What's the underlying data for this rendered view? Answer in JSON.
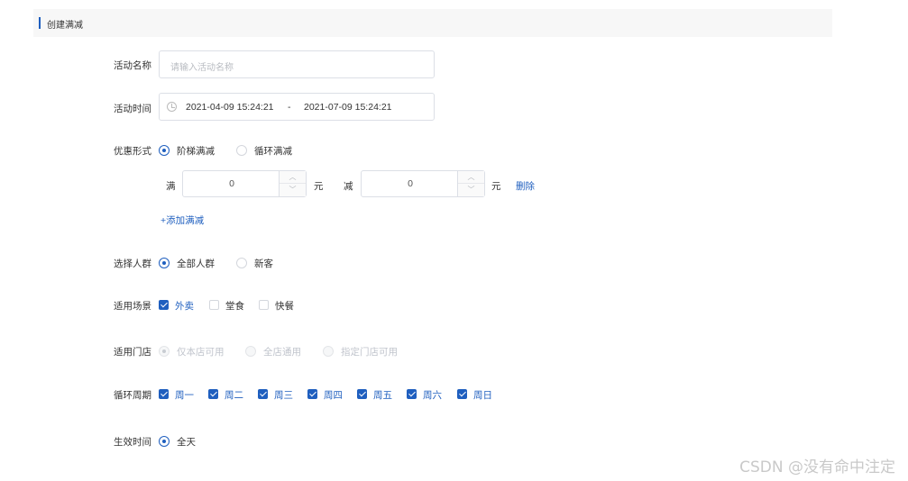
{
  "header": {
    "title": "创建满减"
  },
  "form": {
    "name": {
      "label": "活动名称",
      "placeholder": "请输入活动名称",
      "value": ""
    },
    "time": {
      "label": "活动时间",
      "start": "2021-04-09 15:24:21",
      "separator": "-",
      "end": "2021-07-09 15:24:21"
    },
    "discount_type": {
      "label": "优惠形式",
      "options": [
        {
          "label": "阶梯满减",
          "selected": true
        },
        {
          "label": "循环满减",
          "selected": false
        }
      ],
      "rule": {
        "full_label": "满",
        "full_value": "0",
        "unit1": "元",
        "minus_label": "减",
        "minus_value": "0",
        "unit2": "元",
        "delete_label": "删除"
      },
      "add_label": "+添加满减"
    },
    "audience": {
      "label": "选择人群",
      "options": [
        {
          "label": "全部人群",
          "selected": true
        },
        {
          "label": "新客",
          "selected": false
        }
      ]
    },
    "scene": {
      "label": "适用场景",
      "options": [
        {
          "label": "外卖",
          "checked": true
        },
        {
          "label": "堂食",
          "checked": false
        },
        {
          "label": "快餐",
          "checked": false
        }
      ]
    },
    "store": {
      "label": "适用门店",
      "options": [
        {
          "label": "仅本店可用",
          "selected": true
        },
        {
          "label": "全店通用",
          "selected": false
        },
        {
          "label": "指定门店可用",
          "selected": false
        }
      ]
    },
    "cycle": {
      "label": "循环周期",
      "days": [
        "周一",
        "周二",
        "周三",
        "周四",
        "周五",
        "周六",
        "周日"
      ]
    },
    "effective": {
      "label": "生效时间",
      "options": [
        {
          "label": "全天",
          "selected": true
        }
      ]
    }
  },
  "watermark": "CSDN @没有命中注定",
  "colors": {
    "accent": "#1f5fbf",
    "header_bg": "#f7f7f7",
    "border": "#dcdfe6"
  }
}
